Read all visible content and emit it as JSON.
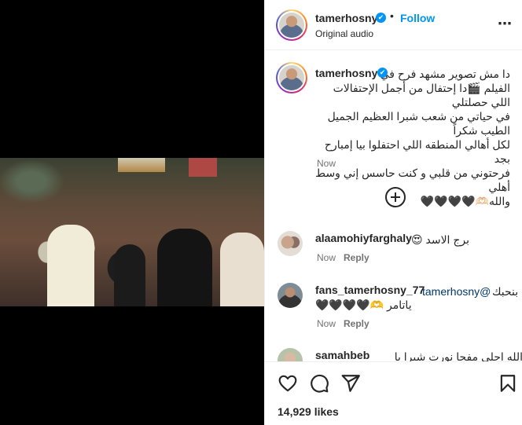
{
  "header": {
    "username": "tamerhosny",
    "verified_glyph": "✔",
    "separator": "•",
    "follow_label": "Follow",
    "audio": "Original audio",
    "more_icon": "⋯"
  },
  "caption": {
    "username": "tamerhosny",
    "text": "دا مش تصوير مشهد فرح في\nالفيلم 🎬دا إحتفال من أجمل الإحتفالات اللي حصلتلي\nفي حياتي من شعب شبرا العظيم الجميل الطيب شكراً\nلكل أهالي المنطقه اللي احتفلوا بيا إمبارح بجد\nفرحتوني من قلبي و كنت حاسس إني وسط أهلي\nوالله🫶🏻🖤🖤🖤🖤",
    "time": "Now"
  },
  "comments": [
    {
      "username": "alaamohiyfarghaly",
      "text": "برج الاسد 😍",
      "time": "Now",
      "reply_label": "Reply"
    },
    {
      "username": "fans_tamerhosny_77",
      "mention": "@tamerhosny",
      "text_line1": "بنحبك",
      "text_line2": "ياتامر 🫶🖤🖤🖤🖤",
      "time": "Now",
      "reply_label": "Reply"
    },
    {
      "username": "samahbeb",
      "text": "الله احلي مفجا نورت شبرا يا تامر والله"
    }
  ],
  "actions": {
    "like_icon": "heart-icon",
    "comment_icon": "comment-icon",
    "share_icon": "share-icon",
    "save_icon": "bookmark-icon",
    "likes": "14,929 likes"
  },
  "colors": {
    "accent": "#0095f6",
    "muted": "#737373",
    "text": "#262626"
  }
}
